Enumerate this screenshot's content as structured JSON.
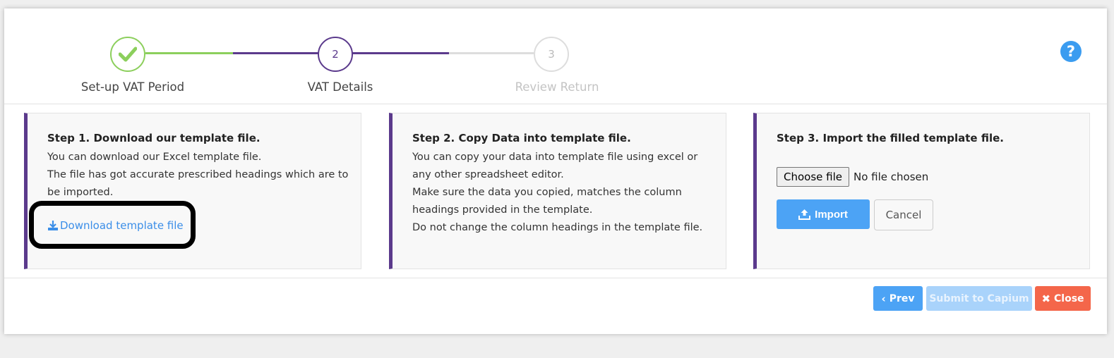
{
  "stepper": {
    "steps": [
      {
        "label": "Set-up VAT Period",
        "number": "",
        "state": "done"
      },
      {
        "label": "VAT Details",
        "number": "2",
        "state": "active"
      },
      {
        "label": "Review Return",
        "number": "3",
        "state": "pending"
      }
    ],
    "help_icon": "question-circle-icon"
  },
  "panels": [
    {
      "title": "Step 1. Download our template file.",
      "lines": [
        "You can download our Excel template file.",
        "The file has got accurate prescribed headings which are to",
        "be imported."
      ],
      "link_label": "Download template file"
    },
    {
      "title": "Step 2. Copy Data into template file.",
      "lines": [
        "You can copy your data into template file using excel or",
        "any other spreadsheet editor.",
        "Make sure the data you copied, matches the column",
        "headings provided in the template.",
        "Do not change the column headings in the template file."
      ]
    },
    {
      "title": "Step 3. Import the filled template file.",
      "file_button": "Choose file",
      "file_status": "No file chosen",
      "import_label": "Import",
      "cancel_label": "Cancel"
    }
  ],
  "footer": {
    "prev_label": "Prev",
    "submit_label": "Submit to Capium",
    "close_label": "Close"
  },
  "colors": {
    "done": "#8ccf5c",
    "active": "#5b3a8c",
    "pending": "#dddddd",
    "primary": "#4ca3f5",
    "danger": "#f4664a"
  }
}
